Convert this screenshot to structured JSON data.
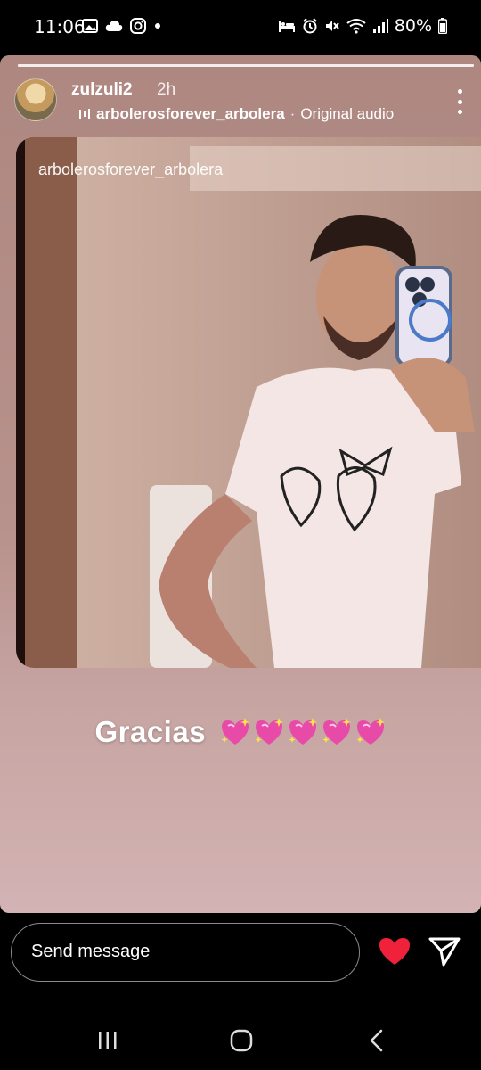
{
  "status_bar": {
    "time": "11:06",
    "battery": "80%",
    "left_icons": [
      "gallery-icon",
      "cloud-icon",
      "instagram-icon",
      "dot-icon"
    ],
    "right_icons": [
      "bed-icon",
      "alarm-icon",
      "mute-icon",
      "wifi-icon",
      "signal-icon",
      "battery-icon"
    ]
  },
  "story": {
    "progress_segments": 1,
    "username": "zulzuli2",
    "time_ago": "2h",
    "audio_owner": "arbolerosforever_arbolera",
    "audio_separator": "·",
    "audio_label": "Original audio",
    "media_caption": "arbolerosforever_arbolera",
    "caption_text": "Gracias",
    "caption_emoji_count": 5,
    "colors": {
      "heart_emoji": "#e84aa8",
      "like_heart": "#f0213b"
    }
  },
  "bottom_bar": {
    "message_placeholder": "Send message"
  }
}
